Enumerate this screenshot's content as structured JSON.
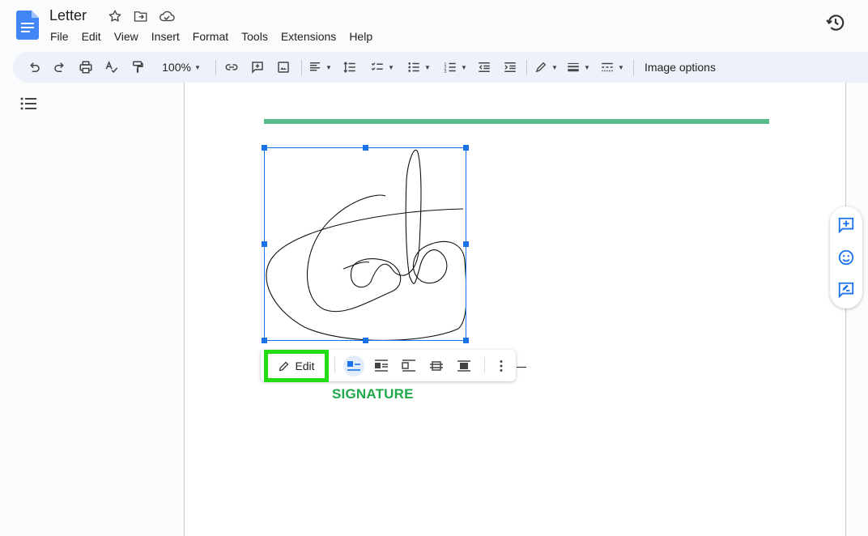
{
  "document": {
    "title": "Letter"
  },
  "menu": [
    "File",
    "Edit",
    "View",
    "Insert",
    "Format",
    "Tools",
    "Extensions",
    "Help"
  ],
  "toolbar": {
    "zoom": "100%",
    "image_options": "Image options"
  },
  "image_toolbar": {
    "edit_label": "Edit"
  },
  "page_text": {
    "signature_label": "SIGNATURE"
  },
  "colors": {
    "accent": "#1a73e8",
    "rule": "#57bb8a",
    "highlight": "#22dd11",
    "signature_label": "#1ea84a"
  }
}
